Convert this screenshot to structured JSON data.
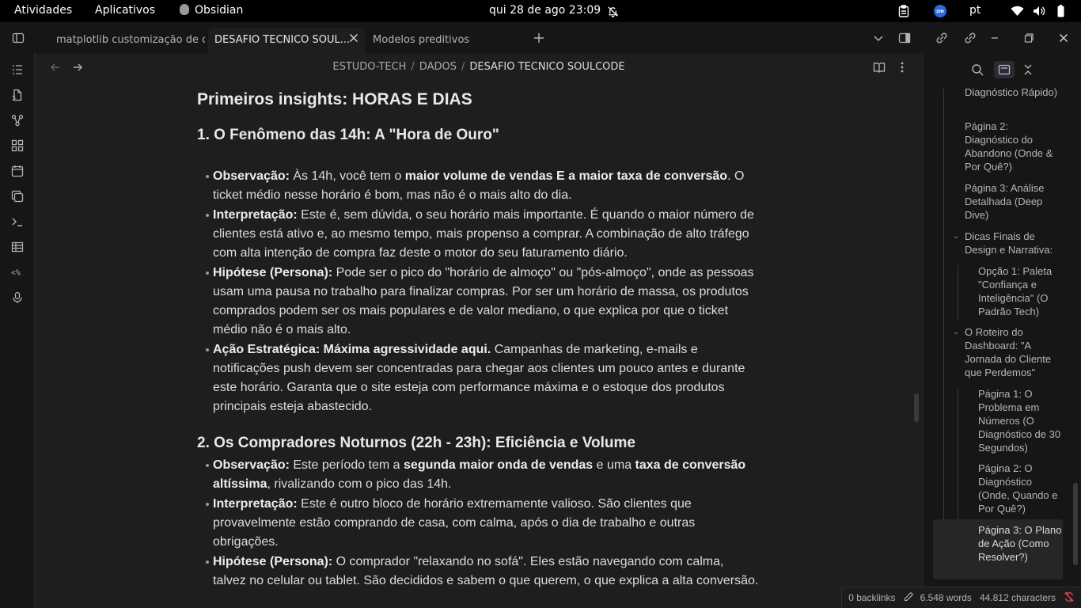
{
  "system_bar": {
    "activities": "Atividades",
    "applications": "Aplicativos",
    "app_name": "Obsidian",
    "clock": "qui 28 de ago  23:09",
    "zoom_badge": "zm",
    "language": "pt",
    "icons": [
      "bell-off-icon",
      "clipboard-icon",
      "zoom-icon",
      "wifi-icon",
      "volume-icon",
      "battery-icon"
    ]
  },
  "tabs": [
    {
      "label": "matplotlib customização de c..."
    },
    {
      "label": "DESAFIO TECNICO SOUL..."
    },
    {
      "label": "Modelos preditivos"
    }
  ],
  "ribbon_icons": [
    "file-explorer-icon",
    "open-file-icon",
    "graph-icon",
    "canvas-icon",
    "daily-note-icon",
    "templates-icon",
    "command-palette-icon",
    "table-icon",
    "regex-icon",
    "microphone-icon"
  ],
  "breadcrumb": [
    "ESTUDO-TECH",
    "DADOS",
    "DESAFIO TECNICO SOULCODE"
  ],
  "document": {
    "heading_main": "Primeiros insights: HORAS E DIAS",
    "section1": {
      "title": "1. O Fenômeno das 14h: A \"Hora de Ouro\"",
      "obs_label": "Observação:",
      "obs_a": " Às 14h, você tem o ",
      "obs_b": "maior volume de vendas E a maior taxa de conversão",
      "obs_c": ". O ticket médio nesse horário é bom, mas não é o mais alto do dia.",
      "int_label": "Interpretação:",
      "int_text": " Este é, sem dúvida, o seu horário mais importante. É quando o maior número de clientes está ativo e, ao mesmo tempo, mais propenso a comprar. A combinação de alto tráfego com alta intenção de compra faz deste o motor do seu faturamento diário.",
      "hyp_label": "Hipótese (Persona):",
      "hyp_text": " Pode ser o pico do \"horário de almoço\" ou \"pós-almoço\", onde as pessoas usam uma pausa no trabalho para finalizar compras. Por ser um horário de massa, os produtos comprados podem ser os mais populares e de valor mediano, o que explica por que o ticket médio não é o mais alto.",
      "act_label": "Ação Estratégica: Máxima agressividade aqui.",
      "act_text": " Campanhas de marketing, e-mails e notificações push devem ser concentradas para chegar aos clientes um pouco antes e durante este horário. Garanta que o site esteja com performance máxima e o estoque dos produtos principais esteja abastecido."
    },
    "section2": {
      "title": "2. Os Compradores Noturnos (22h - 23h): Eficiência e Volume",
      "obs_label": "Observação:",
      "obs_a": " Este período tem a ",
      "obs_b": "segunda maior onda de vendas",
      "obs_c": " e uma ",
      "obs_d": "taxa de conversão altíssima",
      "obs_e": ", rivalizando com o pico das 14h.",
      "int_label": "Interpretação:",
      "int_text": " Este é outro bloco de horário extremamente valioso. São clientes que provavelmente estão comprando de casa, com calma, após o dia de trabalho e outras obrigações.",
      "hyp_label": "Hipótese (Persona):",
      "hyp_text": " O comprador \"relaxando no sofá\". Eles estão navegando com calma, talvez no celular ou tablet. São decididos e sabem o que querem, o que explica a alta conversão."
    }
  },
  "outline": [
    {
      "text": "Diagnóstico Rápido)"
    },
    {
      "text": "Página 2: Diagnóstico do Abandono (Onde & Por Quê?)"
    },
    {
      "text": "Página 3: Análise Detalhada (Deep Dive)"
    },
    {
      "text": "Dicas Finais de Design e Narrativa:"
    },
    {
      "text": "Opção 1: Paleta \"Confiança e Inteligência\" (O Padrão Tech)"
    },
    {
      "text": "O Roteiro do Dashboard: \"A Jornada do Cliente que Perdemos\""
    },
    {
      "text": "Página 1: O Problema em Números (O Diagnóstico de 30 Segundos)"
    },
    {
      "text": "Página 2: O Diagnóstico (Onde, Quando e Por Quê?)"
    },
    {
      "text": "Página 3: O Plano de Ação (Como Resolver?)"
    }
  ],
  "status": {
    "backlinks": "0 backlinks",
    "words": "6.548 words",
    "characters": "44.812 characters"
  }
}
